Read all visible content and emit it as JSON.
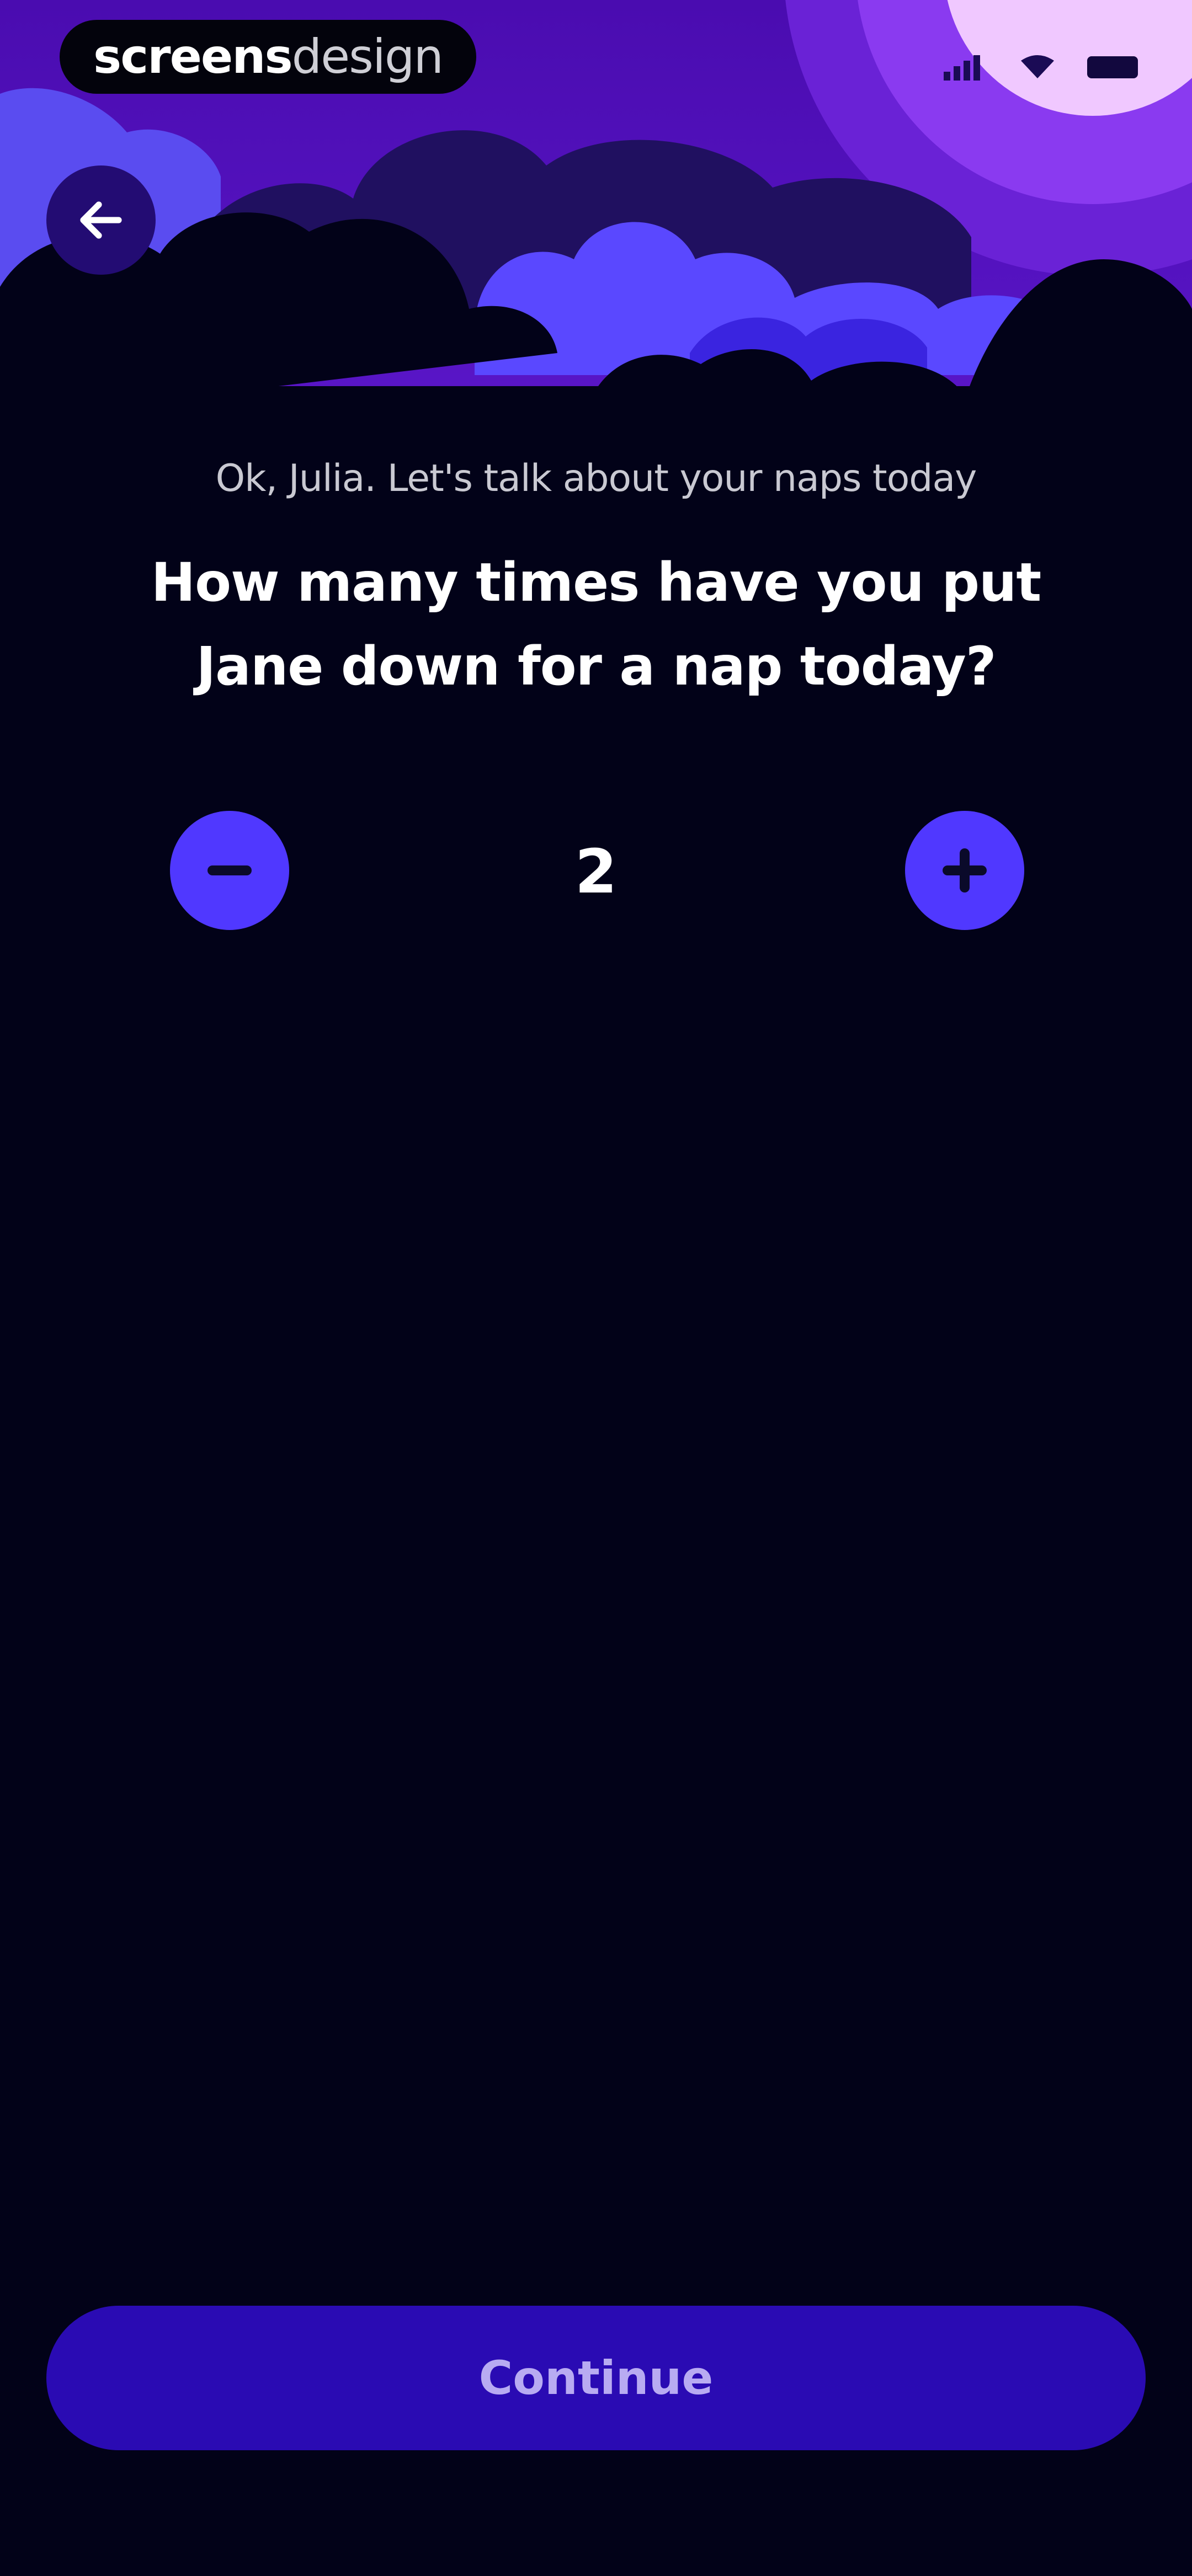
{
  "brand": {
    "part1": "screens",
    "part2": "design"
  },
  "header": {
    "back_icon": "arrow-left-icon"
  },
  "prompt": {
    "subtitle": "Ok, Julia. Let's talk about your naps today",
    "question": "How many times have you put Jane down for a nap today?"
  },
  "stepper": {
    "value": "2",
    "minus_icon": "minus-icon",
    "plus_icon": "plus-icon"
  },
  "footer": {
    "continue_label": "Continue"
  },
  "colors": {
    "background": "#020218",
    "accent": "#5038ff",
    "button": "#2a0bb3",
    "sky_purple": "#4b10b0"
  }
}
